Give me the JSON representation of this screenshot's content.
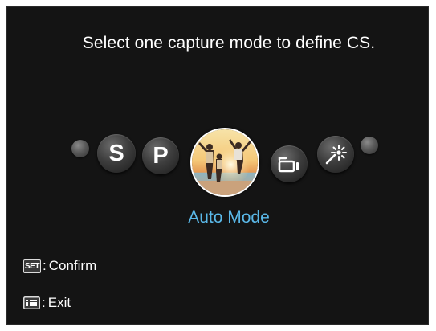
{
  "screen": {
    "title": "Select one capture mode to define CS.",
    "selected_mode_label": "Auto Mode"
  },
  "modes": [
    {
      "name": "S",
      "icon": "letter"
    },
    {
      "name": "P",
      "icon": "letter"
    },
    {
      "name": "Auto",
      "icon": "auto-photo-icon",
      "selected": true
    },
    {
      "name": "Video",
      "icon": "video-camera-icon"
    },
    {
      "name": "Scene",
      "icon": "magic-wand-icon"
    }
  ],
  "hints": {
    "confirm": {
      "key": "SET",
      "separator": ":",
      "label": "Confirm"
    },
    "exit": {
      "key_icon": "menu-icon",
      "separator": ":",
      "label": "Exit"
    }
  },
  "colors": {
    "background": "#141414",
    "selected_label": "#5ab8e8",
    "text": "#ffffff"
  }
}
